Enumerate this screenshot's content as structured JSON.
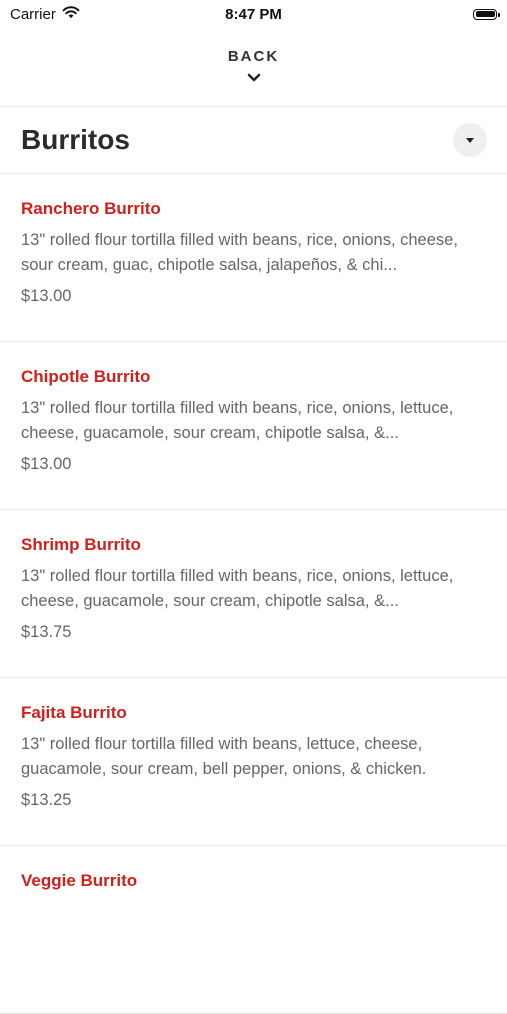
{
  "status_bar": {
    "carrier": "Carrier",
    "time": "8:47 PM",
    "battery_level": 1.0
  },
  "nav": {
    "back_label": "BACK",
    "back_icon": "chevron-down-icon"
  },
  "section": {
    "title": "Burritos",
    "dropdown_icon": "caret-down-icon"
  },
  "menu_items": [
    {
      "name": "Ranchero Burrito",
      "description": "13\" rolled flour tortilla filled with beans, rice, onions, cheese, sour cream, guac, chipotle salsa, jalapeños, & chi...",
      "price": "$13.00"
    },
    {
      "name": "Chipotle Burrito",
      "description": "13\" rolled flour tortilla filled with beans, rice, onions, lettuce, cheese, guacamole, sour cream, chipotle salsa, &...",
      "price": "$13.00"
    },
    {
      "name": "Shrimp Burrito",
      "description": "13\" rolled flour tortilla filled with beans, rice, onions, lettuce, cheese, guacamole, sour cream, chipotle salsa, &...",
      "price": "$13.75"
    },
    {
      "name": "Fajita Burrito",
      "description": "13\" rolled flour tortilla filled with beans, lettuce, cheese, guacamole, sour cream, bell pepper, onions, & chicken.",
      "price": "$13.25"
    },
    {
      "name": "Veggie Burrito",
      "description": "",
      "price": ""
    }
  ],
  "colors": {
    "item_name": "#d0201b",
    "text_secondary": "#666666",
    "divider": "#e8e8e8"
  }
}
